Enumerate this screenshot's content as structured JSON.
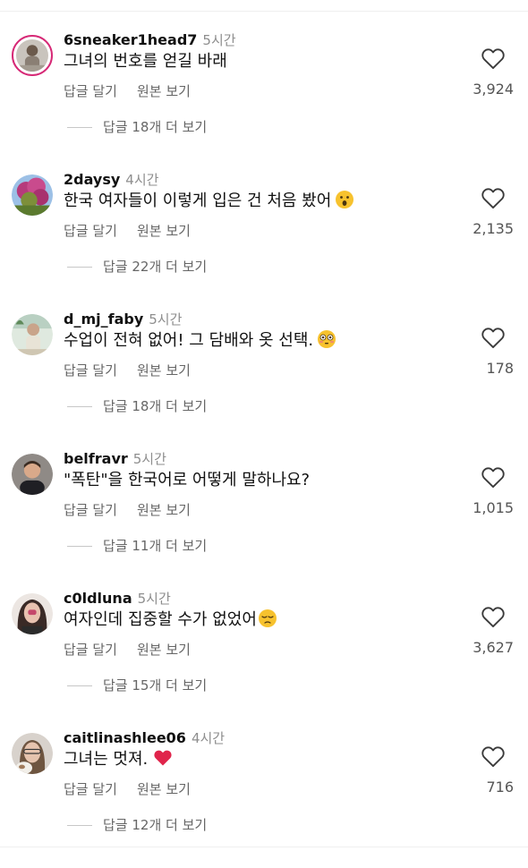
{
  "colors": {
    "story_ring": "#d62976",
    "heart_red": "#e0244b",
    "muted_text": "#8e8e8e",
    "action_text": "#666666"
  },
  "actions": {
    "reply_label": "답글 달기",
    "see_original_label": "원본 보기"
  },
  "comments": [
    {
      "username": "6sneaker1head7",
      "time": "5시간",
      "text": "그녀의 번호를 얻길 바래",
      "emoji": "",
      "likes": "3,924",
      "view_replies": "답글 18개 더 보기",
      "avatar_icon": "user-avatar-icon"
    },
    {
      "username": "2daysy",
      "time": "4시간",
      "text": "한국 여자들이 이렇게 입은 건 처음 봤어",
      "emoji": "astonished-face-emoji",
      "likes": "2,135",
      "view_replies": "답글 22개 더 보기",
      "avatar_icon": "flower-tree-avatar-icon"
    },
    {
      "username": "d_mj_faby",
      "time": "5시간",
      "text": "수업이 전혀 없어! 그 담배와 옷 선택.",
      "emoji": "flushed-face-emoji",
      "likes": "178",
      "view_replies": "답글 18개 더 보기",
      "avatar_icon": "user-avatar-icon"
    },
    {
      "username": "belfravr",
      "time": "5시간",
      "text": "\"폭탄\"을 한국어로 어떻게 말하나요?",
      "emoji": "",
      "likes": "1,015",
      "view_replies": "답글 11개 더 보기",
      "avatar_icon": "user-avatar-icon"
    },
    {
      "username": "c0ldluna",
      "time": "5시간",
      "text": "여자인데 집중할 수가 없었어",
      "emoji": "pensive-face-emoji",
      "likes": "3,627",
      "view_replies": "답글 15개 더 보기",
      "avatar_icon": "user-avatar-icon"
    },
    {
      "username": "caitlinashlee06",
      "time": "4시간",
      "text": "그녀는 멋져.",
      "emoji": "red-heart-emoji",
      "likes": "716",
      "view_replies": "답글 12개 더 보기",
      "avatar_icon": "user-avatar-icon"
    }
  ]
}
